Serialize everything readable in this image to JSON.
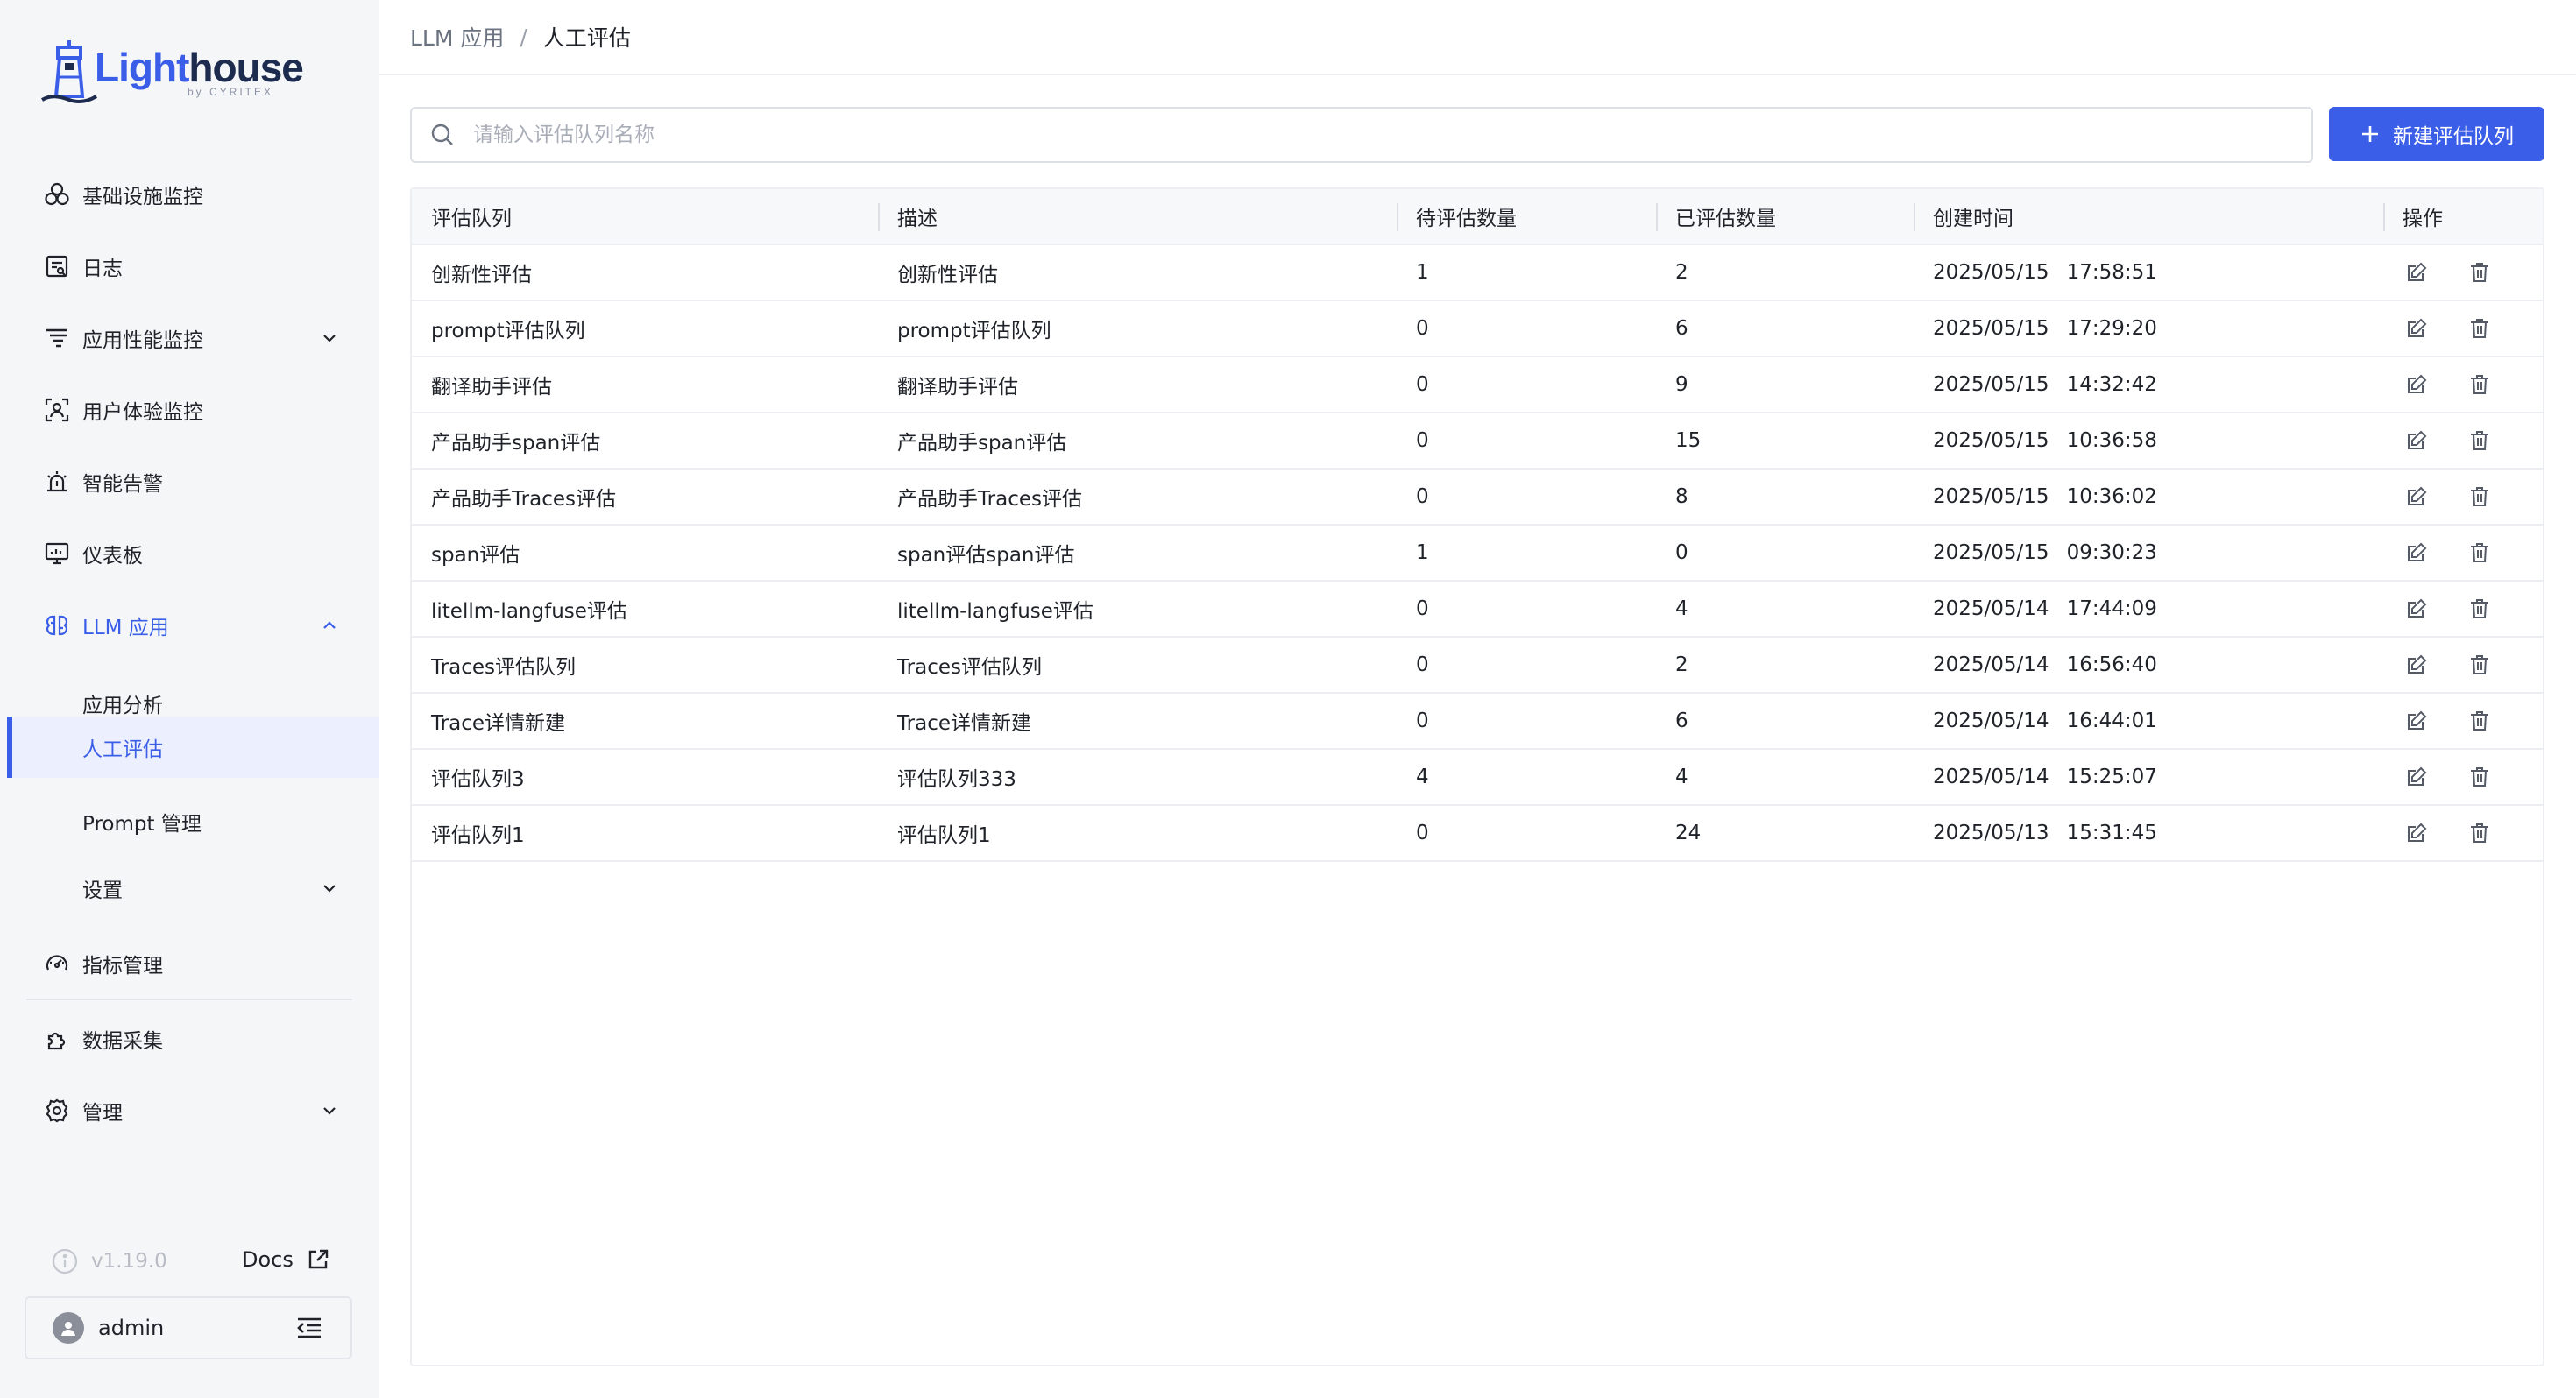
{
  "app": {
    "logo_light": "Light",
    "logo_house": "house",
    "logo_sub": "by CYRITEX"
  },
  "sidebar": {
    "items": [
      {
        "label": "基础设施监控",
        "icon": "cluster-icon"
      },
      {
        "label": "日志",
        "icon": "log-icon"
      },
      {
        "label": "应用性能监控",
        "icon": "apm-icon",
        "expandable": true
      },
      {
        "label": "用户体验监控",
        "icon": "user-experience-icon"
      },
      {
        "label": "智能告警",
        "icon": "alarm-icon"
      },
      {
        "label": "仪表板",
        "icon": "dashboard-icon"
      },
      {
        "label": "LLM 应用",
        "icon": "llm-icon",
        "expanded": true
      },
      {
        "label": "指标管理",
        "icon": "metrics-icon"
      },
      {
        "label": "数据采集",
        "icon": "plugin-icon"
      },
      {
        "label": "管理",
        "icon": "settings-icon",
        "expandable": true
      }
    ],
    "llm_sub": [
      "应用分析",
      "人工评估",
      "Prompt 管理",
      "设置"
    ],
    "active_sub": "人工评估",
    "version": "v1.19.0",
    "docs": "Docs",
    "user": "admin"
  },
  "breadcrumb": {
    "parent": "LLM 应用",
    "separator": "/",
    "current": "人工评估"
  },
  "search": {
    "placeholder": "请输入评估队列名称",
    "value": ""
  },
  "toolbar": {
    "new_queue_label": "新建评估队列"
  },
  "table": {
    "headers": [
      "评估队列",
      "描述",
      "待评估数量",
      "已评估数量",
      "创建时间",
      "操作"
    ],
    "rows": [
      {
        "name": "创新性评估",
        "desc": "创新性评估",
        "pending": "1",
        "done": "2",
        "date": "2025/05/15",
        "time": "17:58:51"
      },
      {
        "name": "prompt评估队列",
        "desc": "prompt评估队列",
        "pending": "0",
        "done": "6",
        "date": "2025/05/15",
        "time": "17:29:20"
      },
      {
        "name": "翻译助手评估",
        "desc": "翻译助手评估",
        "pending": "0",
        "done": "9",
        "date": "2025/05/15",
        "time": "14:32:42"
      },
      {
        "name": "产品助手span评估",
        "desc": "产品助手span评估",
        "pending": "0",
        "done": "15",
        "date": "2025/05/15",
        "time": "10:36:58"
      },
      {
        "name": "产品助手Traces评估",
        "desc": "产品助手Traces评估",
        "pending": "0",
        "done": "8",
        "date": "2025/05/15",
        "time": "10:36:02"
      },
      {
        "name": "span评估",
        "desc": "span评估span评估",
        "pending": "1",
        "done": "0",
        "date": "2025/05/15",
        "time": "09:30:23"
      },
      {
        "name": "litellm-langfuse评估",
        "desc": "litellm-langfuse评估",
        "pending": "0",
        "done": "4",
        "date": "2025/05/14",
        "time": "17:44:09"
      },
      {
        "name": "Traces评估队列",
        "desc": "Traces评估队列",
        "pending": "0",
        "done": "2",
        "date": "2025/05/14",
        "time": "16:56:40"
      },
      {
        "name": "Trace详情新建",
        "desc": "Trace详情新建",
        "pending": "0",
        "done": "6",
        "date": "2025/05/14",
        "time": "16:44:01"
      },
      {
        "name": "评估队列3",
        "desc": "评估队列333",
        "pending": "4",
        "done": "4",
        "date": "2025/05/14",
        "time": "15:25:07"
      },
      {
        "name": "评估队列1",
        "desc": "评估队列1",
        "pending": "0",
        "done": "24",
        "date": "2025/05/13",
        "time": "15:31:45"
      }
    ]
  },
  "colors": {
    "accent": "#3b5ee8",
    "sidebar_bg": "#f5f6f8",
    "active_bg": "#eceffd",
    "border": "#eceef2"
  }
}
